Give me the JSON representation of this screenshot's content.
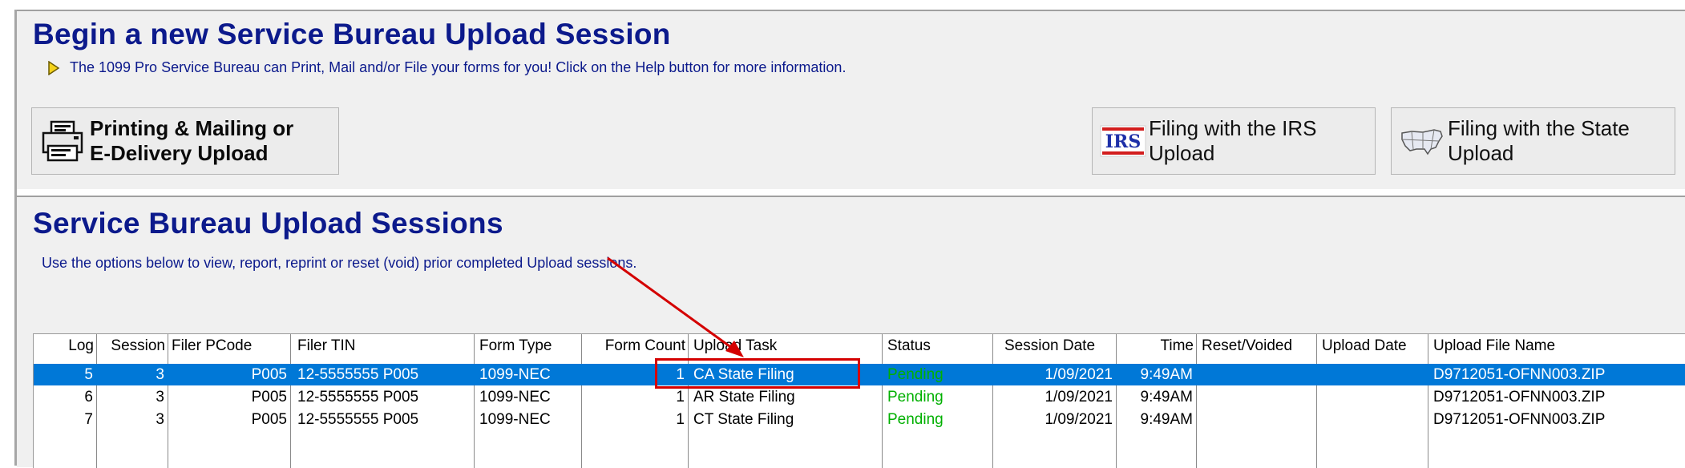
{
  "top_panel": {
    "title": "Begin a new Service Bureau Upload Session",
    "info_text": "The 1099 Pro Service Bureau can Print, Mail and/or File your forms for you!  Click on the Help button for more information.",
    "buttons": {
      "print_line1": "Printing & Mailing or",
      "print_line2": "E-Delivery Upload",
      "irs_badge": "IRS",
      "irs_line1": "Filing with the IRS",
      "irs_line2": "Upload",
      "state_line1": "Filing with the State",
      "state_line2": "Upload"
    }
  },
  "sessions_panel": {
    "title": "Service Bureau Upload Sessions",
    "description": "Use the options below to view, report, reprint or reset (void) prior completed Upload sessions.",
    "columns": {
      "log": "Log",
      "session": "Session",
      "filer_pcode": "Filer PCode",
      "filer_tin": "Filer TIN",
      "form_type": "Form Type",
      "form_count": "Form Count",
      "upload_task": "Upload Task",
      "status": "Status",
      "session_date": "Session Date",
      "time": "Time",
      "reset_voided": "Reset/Voided",
      "upload_date": "Upload Date",
      "upload_file_name": "Upload File Name"
    },
    "rows": [
      {
        "log": "5",
        "session": "3",
        "filer_pcode": "P005",
        "filer_tin": "12-5555555  P005",
        "form_type": "1099-NEC",
        "form_count": "1",
        "upload_task": "CA State Filing",
        "status": "Pending",
        "session_date": "1/09/2021",
        "time": "9:49AM",
        "reset_voided": "",
        "upload_date": "",
        "upload_file_name": "D9712051-OFNN003.ZIP"
      },
      {
        "log": "6",
        "session": "3",
        "filer_pcode": "P005",
        "filer_tin": "12-5555555  P005",
        "form_type": "1099-NEC",
        "form_count": "1",
        "upload_task": "AR State Filing",
        "status": "Pending",
        "session_date": "1/09/2021",
        "time": "9:49AM",
        "reset_voided": "",
        "upload_date": "",
        "upload_file_name": "D9712051-OFNN003.ZIP"
      },
      {
        "log": "7",
        "session": "3",
        "filer_pcode": "P005",
        "filer_tin": "12-5555555  P005",
        "form_type": "1099-NEC",
        "form_count": "1",
        "upload_task": "CT State Filing",
        "status": "Pending",
        "session_date": "1/09/2021",
        "time": "9:49AM",
        "reset_voided": "",
        "upload_date": "",
        "upload_file_name": "D9712051-OFNN003.ZIP"
      }
    ],
    "selected_row": 0
  },
  "colors": {
    "title": "#0c1a8c",
    "selection": "#0078d7",
    "status_pending": "#00b000",
    "annotation": "#d40000"
  },
  "icons": [
    "info-arrow-icon",
    "printer-forms-icon",
    "irs-logo-icon",
    "us-map-icon"
  ]
}
